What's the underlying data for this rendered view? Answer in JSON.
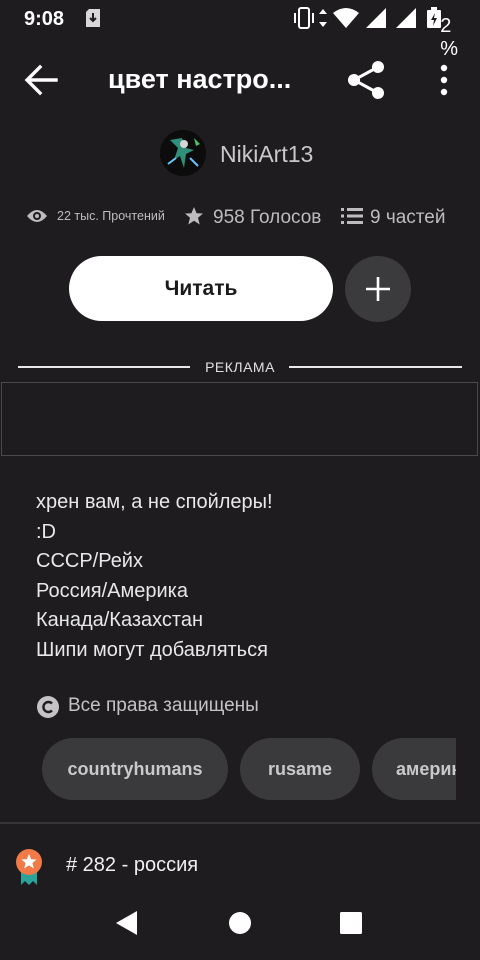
{
  "status_bar": {
    "time": "9:08",
    "battery": "2 %"
  },
  "app_bar": {
    "title": "цвет настро...",
    "back_icon": "arrow-left-icon",
    "share_icon": "share-icon",
    "more_icon": "more-vertical-icon"
  },
  "author": {
    "name": "NikiArt13"
  },
  "stats": {
    "reads": "22 тыс. Прочтений",
    "votes": "958 Голосов",
    "parts": "9 частей"
  },
  "actions": {
    "read_label": "Читать",
    "add_icon": "plus-icon"
  },
  "ad": {
    "label": "РЕКЛАМА"
  },
  "description": {
    "lines": [
      "хрен вам, а не спойлеры!",
      ":D",
      "СССР/Рейх",
      "Россия/Америка",
      "Канада/Казахстан",
      "Шипи могут добавляться"
    ]
  },
  "copyright": {
    "text": "Все права защищены",
    "icon": "copyright-icon"
  },
  "tags": [
    "countryhumans",
    "rusame",
    "америка"
  ],
  "ranking": {
    "text": "# 282 - россия",
    "icon": "rank-badge-icon"
  },
  "colors": {
    "background": "#1e1c1f",
    "button_dark": "#3b3a3d",
    "badge_orange": "#f07a48",
    "badge_ribbon": "#2aa39a"
  }
}
